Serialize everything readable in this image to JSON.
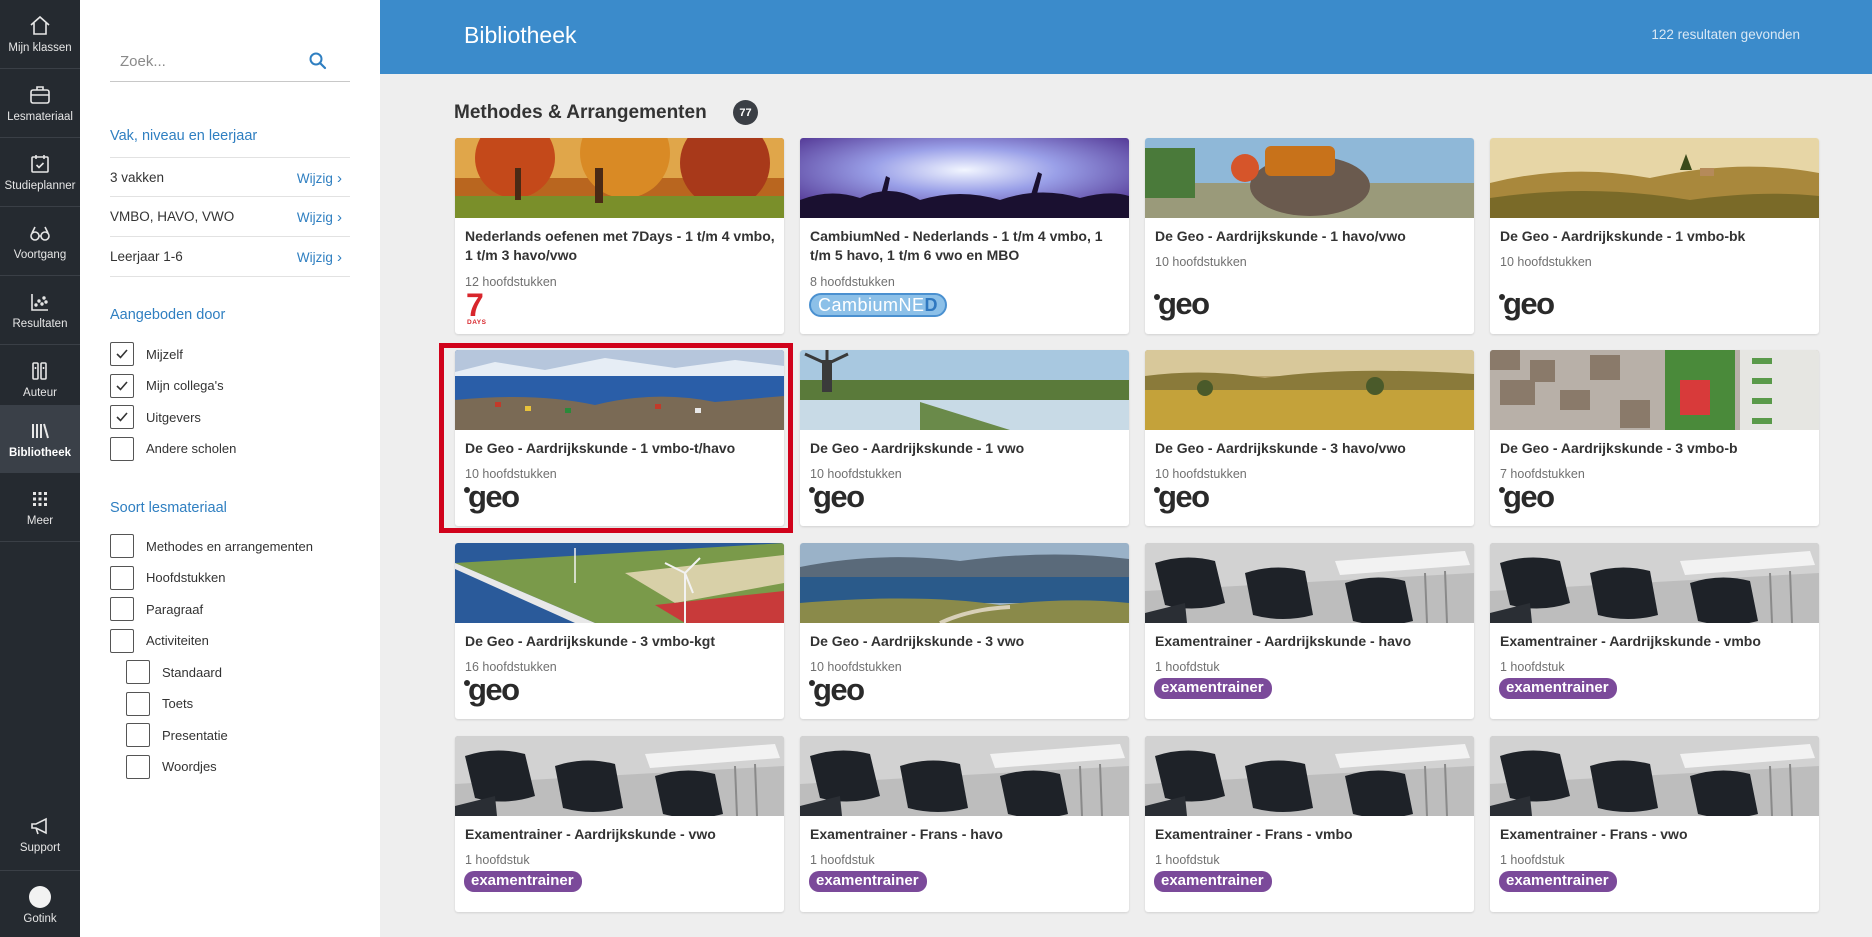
{
  "nav": {
    "items": [
      {
        "label": "Mijn klassen",
        "icon": "home-icon"
      },
      {
        "label": "Lesmateriaal",
        "icon": "briefcase-icon"
      },
      {
        "label": "Studieplanner",
        "icon": "calendar-check-icon"
      },
      {
        "label": "Voortgang",
        "icon": "glasses-icon"
      },
      {
        "label": "Resultaten",
        "icon": "scatter-chart-icon"
      },
      {
        "label": "Auteur",
        "icon": "author-icon"
      },
      {
        "label": "Bibliotheek",
        "icon": "library-icon",
        "active": true
      },
      {
        "label": "Meer",
        "icon": "grid-icon"
      }
    ],
    "support": {
      "label": "Support",
      "icon": "megaphone-icon"
    },
    "user": {
      "label": "Gotink"
    }
  },
  "filters": {
    "search_placeholder": "Zoek...",
    "section1_title": "Vak, niveau en leerjaar",
    "rows": [
      {
        "label": "3 vakken",
        "action": "Wijzig"
      },
      {
        "label": "VMBO, HAVO, VWO",
        "action": "Wijzig"
      },
      {
        "label": "Leerjaar 1-6",
        "action": "Wijzig"
      }
    ],
    "section2_title": "Aangeboden door",
    "offered_by": [
      {
        "label": "Mijzelf",
        "checked": true
      },
      {
        "label": "Mijn collega's",
        "checked": true
      },
      {
        "label": "Uitgevers",
        "checked": true
      },
      {
        "label": "Andere scholen",
        "checked": false
      }
    ],
    "section3_title": "Soort lesmateriaal",
    "material_types": [
      {
        "label": "Methodes en arrangementen",
        "checked": false
      },
      {
        "label": "Hoofdstukken",
        "checked": false
      },
      {
        "label": "Paragraaf",
        "checked": false
      },
      {
        "label": "Activiteiten",
        "checked": false
      }
    ],
    "activity_types": [
      {
        "label": "Standaard",
        "checked": false
      },
      {
        "label": "Toets",
        "checked": false
      },
      {
        "label": "Presentatie",
        "checked": false
      },
      {
        "label": "Woordjes",
        "checked": false
      }
    ]
  },
  "header": {
    "title": "Bibliotheek",
    "results": "122 resultaten gevonden"
  },
  "section": {
    "title": "Methodes & Arrangementen",
    "count": "77"
  },
  "cards": [
    {
      "title": "Nederlands oefenen met 7Days - 1 t/m 4 vmbo, 1 t/m 3 havo/vwo",
      "sub": "12 hoofdstukken",
      "logo": "7days",
      "logo_text": "7",
      "logo_sub": "DAYS",
      "image": "autumn"
    },
    {
      "title": "CambiumNed - Nederlands - 1 t/m 4 vmbo, 1 t/m 5 havo, 1 t/m 6 vwo en MBO",
      "sub": "8 hoofdstukken",
      "logo": "cambium",
      "logo_text": "CambiumNE",
      "logo_text2": "D",
      "image": "concert"
    },
    {
      "title": "De Geo - Aardrijkskunde - 1 havo/vwo",
      "sub": "10 hoofdstukken",
      "logo": "geo",
      "logo_text": "geo",
      "image": "elephant"
    },
    {
      "title": "De Geo - Aardrijkskunde - 1 vmbo-bk",
      "sub": "10 hoofdstukken",
      "logo": "geo",
      "logo_text": "geo",
      "image": "tuscany"
    },
    {
      "title": "De Geo - Aardrijkskunde - 1 vmbo-t/havo",
      "sub": "10 hoofdstukken",
      "logo": "geo",
      "logo_text": "geo",
      "image": "greenland",
      "selected": true
    },
    {
      "title": "De Geo - Aardrijkskunde - 1 vwo",
      "sub": "10 hoofdstukken",
      "logo": "geo",
      "logo_text": "geo",
      "image": "windmill"
    },
    {
      "title": "De Geo - Aardrijkskunde - 3 havo/vwo",
      "sub": "10 hoofdstukken",
      "logo": "geo",
      "logo_text": "geo",
      "image": "savanna"
    },
    {
      "title": "De Geo - Aardrijkskunde - 3 vmbo-b",
      "sub": "7 hoofdstukken",
      "logo": "geo",
      "logo_text": "geo",
      "image": "city"
    },
    {
      "title": "De Geo - Aardrijkskunde - 3 vmbo-kgt",
      "sub": "16 hoofdstukken",
      "logo": "geo",
      "logo_text": "geo",
      "image": "windfarm"
    },
    {
      "title": "De Geo - Aardrijkskunde - 3 vwo",
      "sub": "10 hoofdstukken",
      "logo": "geo",
      "logo_text": "geo",
      "image": "lake"
    },
    {
      "title": "Examentrainer - Aardrijkskunde - havo",
      "sub": "1 hoofdstuk",
      "logo": "exam",
      "logo_text": "examentrainer",
      "image": "chairs"
    },
    {
      "title": "Examentrainer - Aardrijkskunde - vmbo",
      "sub": "1 hoofdstuk",
      "logo": "exam",
      "logo_text": "examentrainer",
      "image": "chairs"
    },
    {
      "title": "Examentrainer - Aardrijkskunde - vwo",
      "sub": "1 hoofdstuk",
      "logo": "exam",
      "logo_text": "examentrainer",
      "image": "chairs"
    },
    {
      "title": "Examentrainer - Frans - havo",
      "sub": "1 hoofdstuk",
      "logo": "exam",
      "logo_text": "examentrainer",
      "image": "chairs"
    },
    {
      "title": "Examentrainer - Frans - vmbo",
      "sub": "1 hoofdstuk",
      "logo": "exam",
      "logo_text": "examentrainer",
      "image": "chairs"
    },
    {
      "title": "Examentrainer - Frans - vwo",
      "sub": "1 hoofdstuk",
      "logo": "exam",
      "logo_text": "examentrainer",
      "image": "chairs"
    }
  ],
  "colors": {
    "nav_bg": "#252a30",
    "header_bg": "#3b8bcb",
    "link": "#2f7fc1",
    "exam_badge": "#7b4a9a",
    "selected_outline": "#d0021b"
  }
}
